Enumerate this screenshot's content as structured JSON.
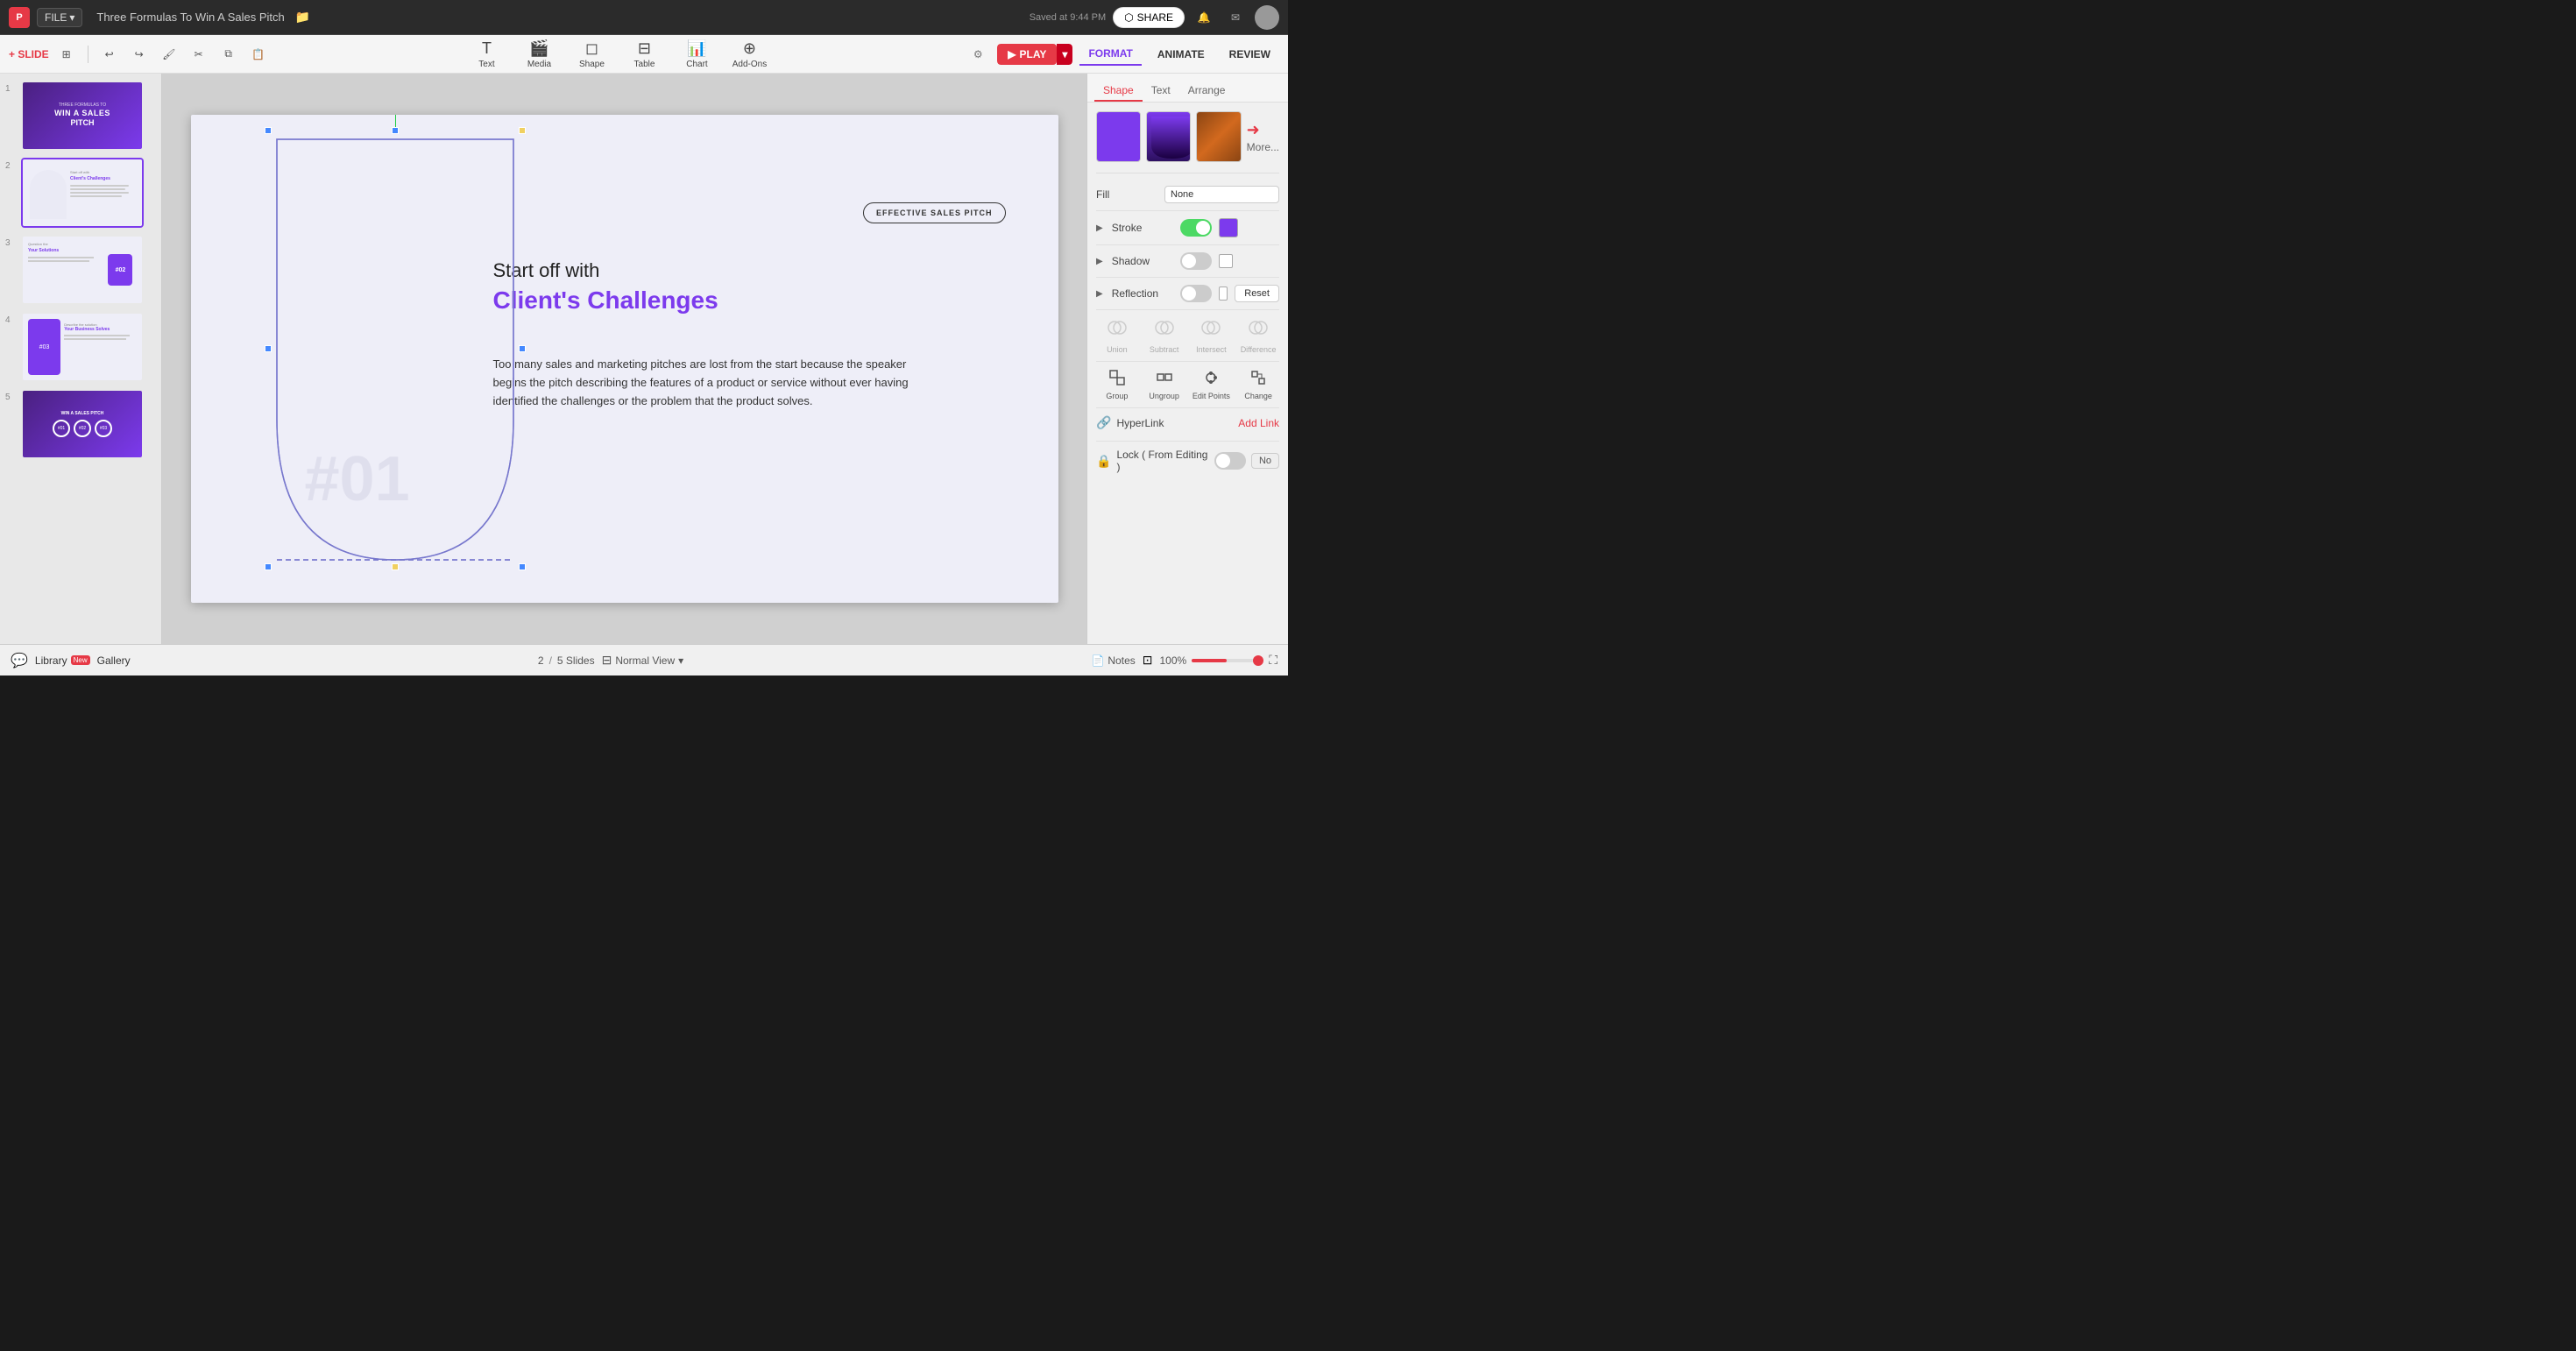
{
  "app": {
    "logo": "P",
    "file_label": "FILE",
    "doc_title": "Three Formulas To Win A Sales Pitch",
    "saved_text": "Saved at 9:44 PM",
    "share_label": "SHARE",
    "play_label": "PLAY"
  },
  "toolbar": {
    "slide_label": "+ SLIDE",
    "tools": [
      {
        "name": "Text",
        "icon": "⊞"
      },
      {
        "name": "Media",
        "icon": "🎬"
      },
      {
        "name": "Shape",
        "icon": "◻"
      },
      {
        "name": "Table",
        "icon": "⊟"
      },
      {
        "name": "Chart",
        "icon": "📊"
      },
      {
        "name": "Add-Ons",
        "icon": "⊕"
      }
    ],
    "format_label": "FORMAT",
    "animate_label": "ANIMATE",
    "review_label": "REVIEW"
  },
  "slides": [
    {
      "num": "1",
      "type": "title"
    },
    {
      "num": "2",
      "type": "content",
      "active": true
    },
    {
      "num": "3",
      "type": "content2"
    },
    {
      "num": "4",
      "type": "content3"
    },
    {
      "num": "5",
      "type": "summary"
    }
  ],
  "slide_content": {
    "badge": "EFFECTIVE SALES PITCH",
    "heading_small": "Start off with",
    "heading_main": "Client's Challenges",
    "body_text": "Too many sales and marketing pitches are lost from the start because the speaker begins the pitch describing the features of a product or service without ever having identified the challenges or the problem that the product solves.",
    "watermark": "#01"
  },
  "right_panel": {
    "tabs": [
      "Shape",
      "Text",
      "Arrange"
    ],
    "active_tab": "Shape",
    "swatches": [
      {
        "name": "purple-solid",
        "color": "purple-solid"
      },
      {
        "name": "purple-gradient",
        "color": "purple-gradient"
      },
      {
        "name": "brown-wood",
        "color": "brown-wood"
      }
    ],
    "more_label": "More...",
    "fill_label": "Fill",
    "fill_value": "None",
    "stroke_label": "Stroke",
    "shadow_label": "Shadow",
    "reflection_label": "Reflection",
    "reset_label": "Reset",
    "bool_ops": [
      "Union",
      "Subtract",
      "Intersect",
      "Difference"
    ],
    "shape_ops": [
      "Group",
      "Ungroup",
      "Edit Points",
      "Change"
    ],
    "hyperlink_label": "HyperLink",
    "add_link_label": "Add Link",
    "lock_label": "Lock ( From Editing )",
    "no_label": "No"
  },
  "bottom_bar": {
    "library_label": "Library",
    "library_badge": "New",
    "gallery_label": "Gallery",
    "slide_current": "2",
    "slide_total": "5 Slides",
    "view_label": "Normal View",
    "notes_label": "Notes",
    "zoom_level": "100%"
  }
}
